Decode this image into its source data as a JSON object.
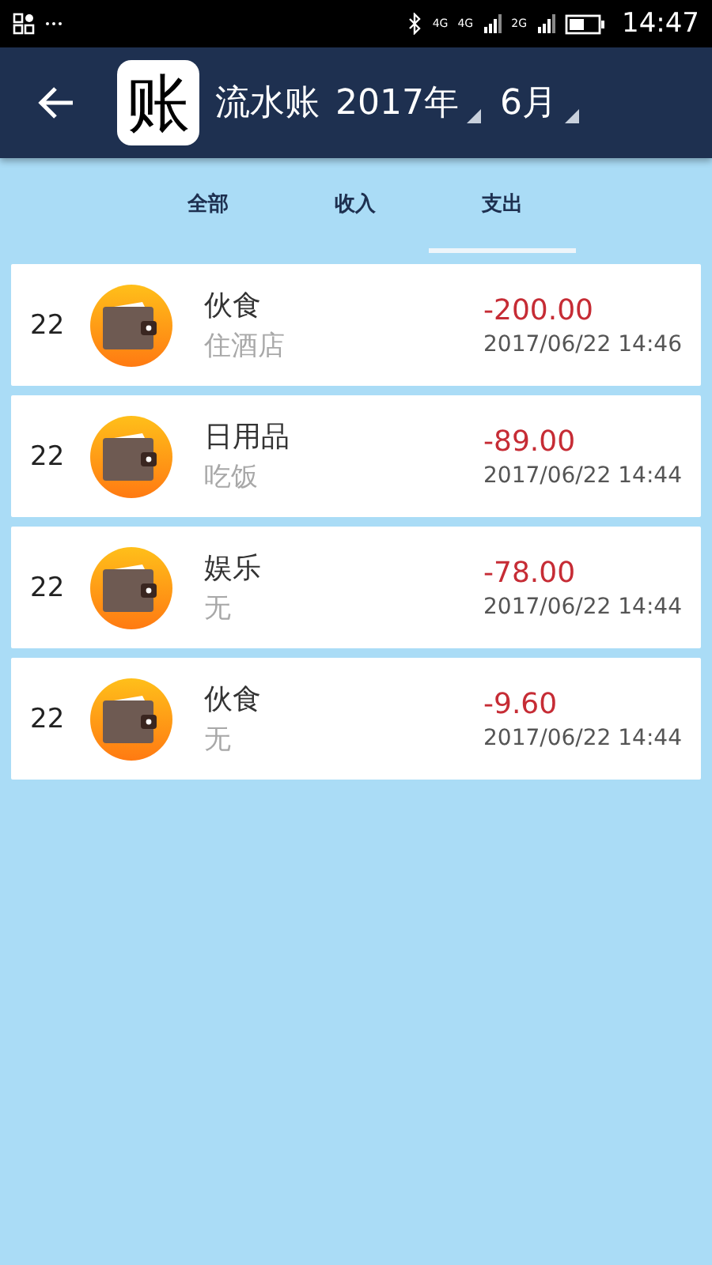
{
  "status_bar": {
    "network_labels": [
      "4G",
      "4G",
      "2G"
    ],
    "time": "14:47"
  },
  "app_bar": {
    "logo": "账",
    "title": "流水账",
    "year": "2017年",
    "month": "6月"
  },
  "tabs": [
    {
      "label": "全部",
      "selected": false
    },
    {
      "label": "收入",
      "selected": false
    },
    {
      "label": "支出",
      "selected": true
    }
  ],
  "entries": [
    {
      "day": "22",
      "category": "伙食",
      "note": "住酒店",
      "amount": "-200.00",
      "time": "2017/06/22 14:46"
    },
    {
      "day": "22",
      "category": "日用品",
      "note": "吃饭",
      "amount": "-89.00",
      "time": "2017/06/22 14:44"
    },
    {
      "day": "22",
      "category": "娱乐",
      "note": "无",
      "amount": "-78.00",
      "time": "2017/06/22 14:44"
    },
    {
      "day": "22",
      "category": "伙食",
      "note": "无",
      "amount": "-9.60",
      "time": "2017/06/22 14:44"
    }
  ]
}
